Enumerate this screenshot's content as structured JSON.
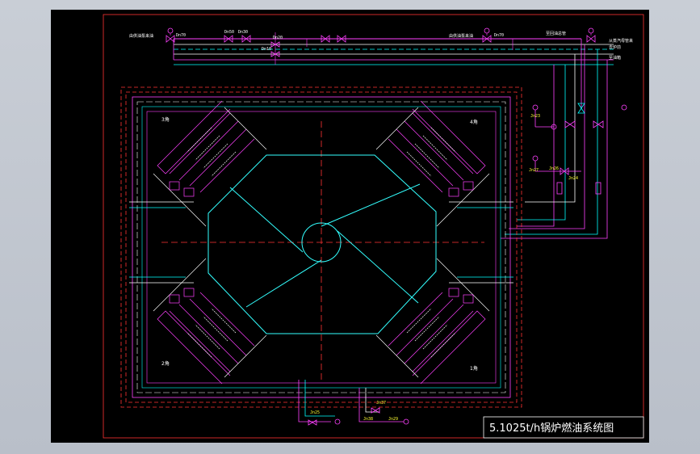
{
  "drawing": {
    "title": "5.1025t/h锅炉燃油系统图",
    "colors": {
      "background": "#000000",
      "frame": "#ff3333",
      "main_pipe": "#ff40ff",
      "return_pipe": "#00ffff",
      "steam_pipe": "#ffffff",
      "center_line": "#ff3333",
      "furnace": "#33ffff",
      "label": "#ffff33",
      "title_box": "#ffffff"
    },
    "corner_labels": {
      "top_left": "3角",
      "top_right": "4角",
      "bottom_left": "2角",
      "bottom_right": "1角"
    },
    "top_header": {
      "left_source": "由供油泵来油",
      "right_source": "由供油泵来油",
      "right_labels": [
        "至回油总管",
        "从蒸汽母管来",
        "去炉前",
        "至油箱"
      ],
      "valve_labels": [
        "Dn70",
        "Dn50",
        "Dn30",
        "Dn20",
        "Dn10",
        "Dn70"
      ]
    },
    "bottom_labels": [
      "Jn25",
      "Jn37",
      "Jn38",
      "Jn29"
    ],
    "right_labels": [
      "Jn23",
      "Jn26",
      "Jn27",
      "Jn24"
    ]
  }
}
